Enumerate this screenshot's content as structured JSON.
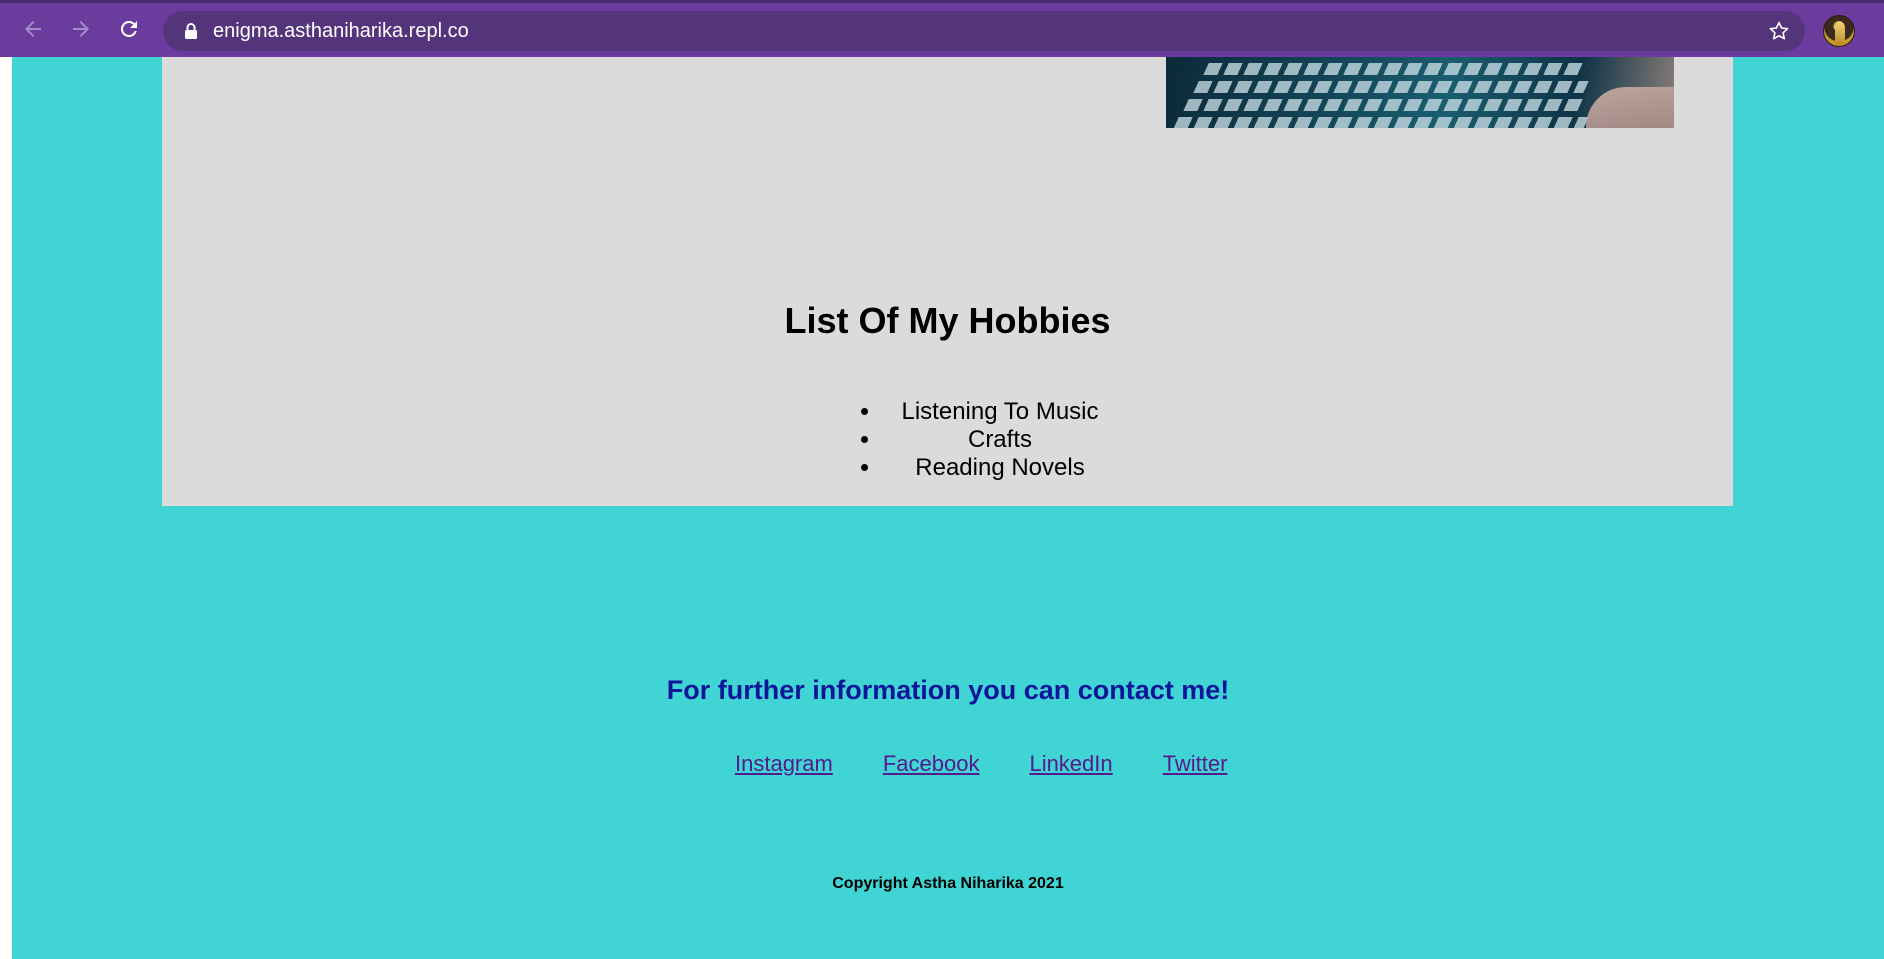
{
  "browser": {
    "url": "enigma.asthaniharika.repl.co",
    "icons": {
      "back": "arrow-left-icon",
      "forward": "arrow-right-icon",
      "reload": "reload-icon",
      "lock": "lock-icon",
      "bookmark": "star-icon"
    },
    "colors": {
      "frame": "#6a3c9e",
      "omnibox": "#54357c"
    }
  },
  "page": {
    "colors": {
      "background": "#40d4d4",
      "card": "#dbdbdb",
      "contact_heading": "#0d1699",
      "link": "#551a8b"
    },
    "hobbies": {
      "title": "List Of My Hobbies",
      "items": [
        "Listening To Music",
        "Crafts",
        "Reading Novels"
      ]
    },
    "contact": {
      "heading": "For further information you can contact me!",
      "links": [
        "Instagram",
        "Facebook",
        "LinkedIn",
        "Twitter"
      ]
    },
    "footer": {
      "copyright": "Copyright Astha Niharika 2021"
    }
  }
}
